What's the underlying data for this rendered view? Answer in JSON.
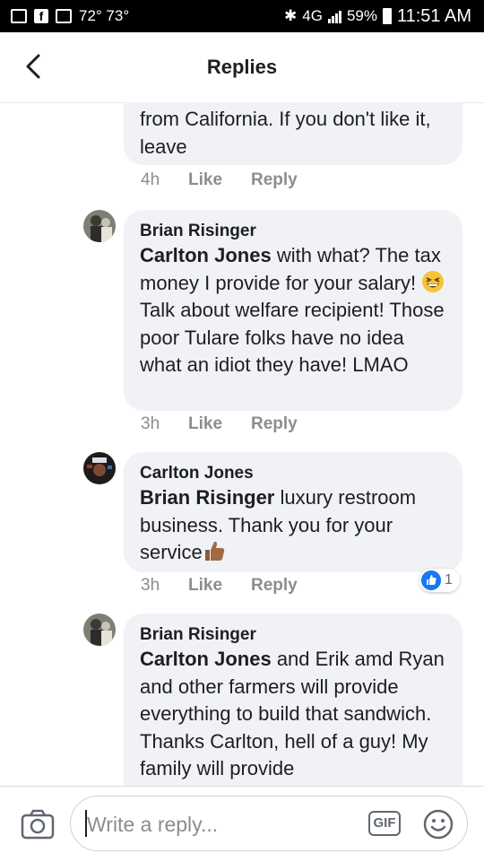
{
  "status_bar": {
    "temperature": "72° 73°",
    "network": "4G",
    "battery": "59%",
    "time": "11:51 AM"
  },
  "header": {
    "title": "Replies",
    "back_icon": "chevron-left-icon"
  },
  "comments": [
    {
      "author": "",
      "text": "from California.  If you don't like it, leave",
      "time": "4h",
      "like_label": "Like",
      "reply_label": "Reply"
    },
    {
      "author": "Brian Risinger",
      "mention": "Carlton Jones",
      "text": " with what? The tax money I provide for your salary! ",
      "emoji": "grinning-squinting-face",
      "text_after": " Talk about welfare recipient! Those poor Tulare folks have no idea what an idiot they have! LMAO",
      "time": "3h",
      "like_label": "Like",
      "reply_label": "Reply"
    },
    {
      "author": "Carlton Jones",
      "mention": "Brian Risinger",
      "text": " luxury restroom business. Thank you for your service",
      "emoji": "thumbs-up-medium-dark-skin",
      "time": "3h",
      "like_label": "Like",
      "reply_label": "Reply",
      "reaction_count": "1"
    },
    {
      "author": "Brian Risinger",
      "mention": "Carlton Jones",
      "text": " and Erik amd Ryan and other farmers will provide everything to build that sandwich. Thanks Carlton, hell of a guy! My family will provide"
    }
  ],
  "composer": {
    "placeholder": "Write a reply...",
    "gif_label": "GIF",
    "camera_icon": "camera-icon",
    "emoji_icon": "smiley-icon"
  },
  "colors": {
    "accent": "#1877f2",
    "bubble": "#f0f2f5",
    "meta_text": "#8a8d91"
  }
}
